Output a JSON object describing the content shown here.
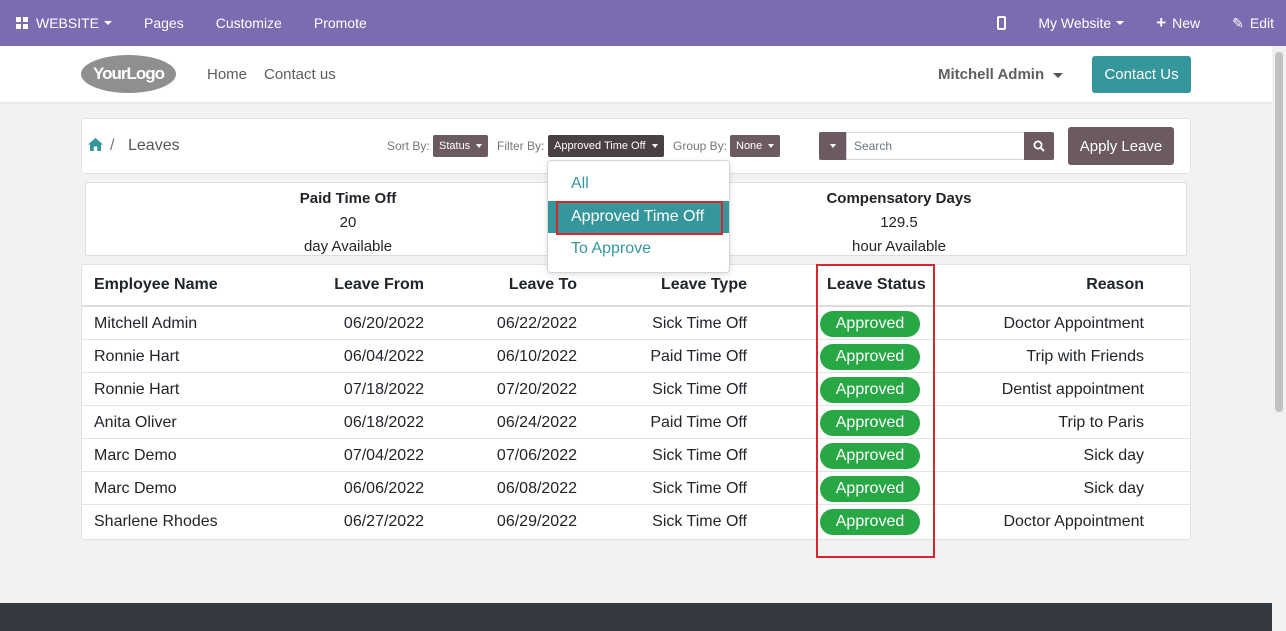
{
  "admin_bar": {
    "website_label": "WEBSITE",
    "pages_label": "Pages",
    "customize_label": "Customize",
    "promote_label": "Promote",
    "site_selector": "My Website",
    "new_label": "New",
    "edit_label": "Edit"
  },
  "header": {
    "logo_text": "YourLogo",
    "nav": [
      "Home",
      "Contact us"
    ],
    "user_name": "Mitchell Admin",
    "contact_button": "Contact Us"
  },
  "toolbar": {
    "breadcrumb_current": "Leaves",
    "breadcrumb_separator": "/",
    "sort_label": "Sort By:",
    "sort_value": "Status",
    "filter_label": "Filter By:",
    "filter_value": "Approved Time Off",
    "group_label": "Group By:",
    "group_value": "None",
    "search_placeholder": "Search",
    "apply_button": "Apply Leave"
  },
  "summary": [
    {
      "title": "Paid Time Off",
      "value": "20",
      "unit": "day Available"
    },
    {
      "title": "Compensatory Days",
      "value": "129.5",
      "unit": "hour Available"
    }
  ],
  "filter_menu": {
    "items": [
      "All",
      "Approved Time Off",
      "To Approve"
    ],
    "selected": "Approved Time Off"
  },
  "table": {
    "headers": [
      "Employee Name",
      "Leave From",
      "Leave To",
      "Leave Type",
      "Leave Status",
      "Reason"
    ],
    "rows": [
      {
        "name": "Mitchell Admin",
        "from": "06/20/2022",
        "to": "06/22/2022",
        "type": "Sick Time Off",
        "status": "Approved",
        "reason": "Doctor Appointment"
      },
      {
        "name": "Ronnie Hart",
        "from": "06/04/2022",
        "to": "06/10/2022",
        "type": "Paid Time Off",
        "status": "Approved",
        "reason": "Trip with Friends"
      },
      {
        "name": "Ronnie Hart",
        "from": "07/18/2022",
        "to": "07/20/2022",
        "type": "Sick Time Off",
        "status": "Approved",
        "reason": "Dentist appointment"
      },
      {
        "name": "Anita Oliver",
        "from": "06/18/2022",
        "to": "06/24/2022",
        "type": "Paid Time Off",
        "status": "Approved",
        "reason": "Trip to Paris"
      },
      {
        "name": "Marc Demo",
        "from": "07/04/2022",
        "to": "07/06/2022",
        "type": "Sick Time Off",
        "status": "Approved",
        "reason": "Sick day"
      },
      {
        "name": "Marc Demo",
        "from": "06/06/2022",
        "to": "06/08/2022",
        "type": "Sick Time Off",
        "status": "Approved",
        "reason": "Sick day"
      },
      {
        "name": "Sharlene Rhodes",
        "from": "06/27/2022",
        "to": "06/29/2022",
        "type": "Sick Time Off",
        "status": "Approved",
        "reason": "Doctor Appointment"
      }
    ]
  },
  "colors": {
    "admin_bar": "#7c6bb0",
    "primary": "#35979c",
    "secondary": "#6b5a61",
    "approved_badge": "#28a745",
    "highlight_border": "#d9262c"
  }
}
